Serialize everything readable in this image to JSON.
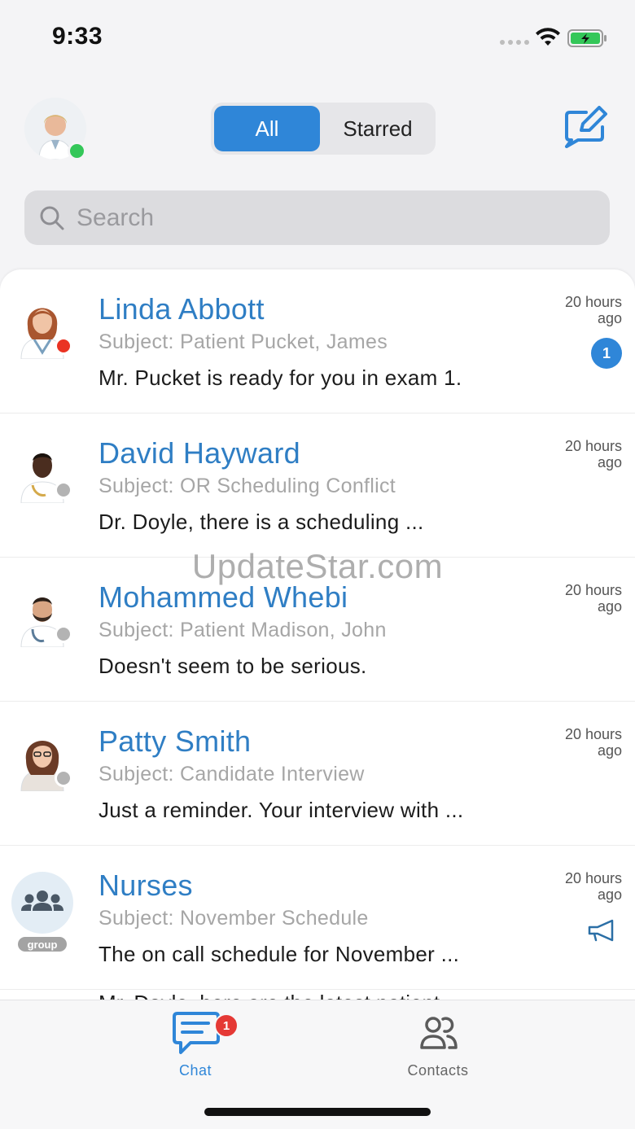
{
  "status_bar": {
    "time": "9:33"
  },
  "header": {
    "segment_all": "All",
    "segment_starred": "Starred"
  },
  "search": {
    "placeholder": "Search"
  },
  "colors": {
    "accent": "#2f86d8",
    "name_blue": "#2f7ec4",
    "online": "#34c759",
    "busy": "#ea3323",
    "offline": "#b3b3b3",
    "badge_red": "#e53935"
  },
  "conversations": [
    {
      "name": "Linda Abbott",
      "subject": "Subject: Patient Pucket, James",
      "message": "Mr. Pucket is ready for you in exam 1.",
      "time": "20 hours ago",
      "status": "busy",
      "unread": "1"
    },
    {
      "name": "David Hayward",
      "subject": "Subject: OR Scheduling Conflict",
      "message": "Dr. Doyle, there is a scheduling ...",
      "time": "20 hours ago",
      "status": "offline"
    },
    {
      "name": "Mohammed Whebi",
      "subject": "Subject: Patient Madison, John",
      "message": "Doesn't seem to be serious.",
      "time": "20 hours ago",
      "status": "offline"
    },
    {
      "name": "Patty Smith",
      "subject": "Subject: Candidate Interview",
      "message": "Just a reminder. Your interview with ...",
      "time": "20 hours ago",
      "status": "offline"
    },
    {
      "name": "Nurses",
      "subject": "Subject: November Schedule",
      "message": "The on call schedule for November ...",
      "time": "20 hours ago",
      "group_tag": "group",
      "icon": "megaphone-icon"
    }
  ],
  "partial_row_message": "Mr. Doyle, here are the latest patient",
  "watermark": "UpdateStar.com",
  "tabs": {
    "chat_label": "Chat",
    "chat_badge": "1",
    "contacts_label": "Contacts"
  }
}
